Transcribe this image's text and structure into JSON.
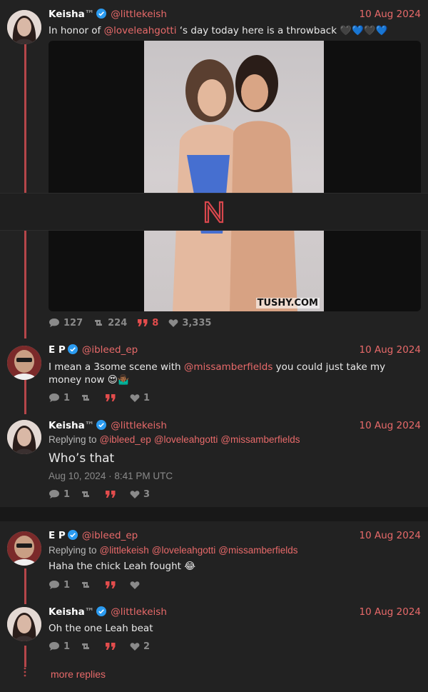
{
  "tweets": [
    {
      "name": "Keisha",
      "tm": "™",
      "handle": "@littlekeish",
      "date": "10 Aug 2024",
      "text_pre": "In honor of ",
      "text_mention": "@loveleahgotti",
      "text_post": " ‘s day today here is a throwback 🖤💙🖤💙",
      "media_watermark": "TUSHY.COM",
      "stats": {
        "replies": "127",
        "retweets": "224",
        "quotes": "8",
        "likes": "3,335"
      }
    },
    {
      "name": "E P",
      "handle": "@ibleed_ep",
      "date": "10 Aug 2024",
      "text_pre": "I mean a 3some scene with ",
      "text_mention": "@missamberfields",
      "text_post": " you could just take my money now 😍🤷🏾‍♂️",
      "stats": {
        "replies": "1",
        "retweets": "",
        "quotes": "",
        "likes": "1"
      }
    },
    {
      "name": "Keisha",
      "tm": "™",
      "handle": "@littlekeish",
      "date": "10 Aug 2024",
      "replying_label": "Replying to",
      "replying": [
        "@ibleed_ep",
        "@loveleahgotti",
        "@missamberfields"
      ],
      "text": "Who’s that",
      "timestamp": "Aug 10, 2024 · 8:41 PM UTC",
      "stats": {
        "replies": "1",
        "retweets": "",
        "quotes": "",
        "likes": "3"
      }
    },
    {
      "name": "E P",
      "handle": "@ibleed_ep",
      "date": "10 Aug 2024",
      "replying_label": "Replying to",
      "replying": [
        "@littlekeish",
        "@loveleahgotti",
        "@missamberfields"
      ],
      "text": "Haha the chick Leah fought 😂",
      "stats": {
        "replies": "1",
        "retweets": "",
        "quotes": "",
        "likes": ""
      }
    },
    {
      "name": "Keisha",
      "tm": "™",
      "handle": "@littlekeish",
      "date": "10 Aug 2024",
      "text": "Oh the one Leah beat",
      "stats": {
        "replies": "1",
        "retweets": "",
        "quotes": "",
        "likes": "2"
      }
    }
  ],
  "more_replies": "more replies",
  "overlay_logo": "N",
  "colors": {
    "accent": "#e86a6a",
    "thread": "#b5464a",
    "quote": "#e24c4c",
    "background": "#181818",
    "card": "#222222"
  },
  "icons": [
    "verified-badge-icon",
    "comment-icon",
    "retweet-icon",
    "quote-icon",
    "heart-icon"
  ]
}
